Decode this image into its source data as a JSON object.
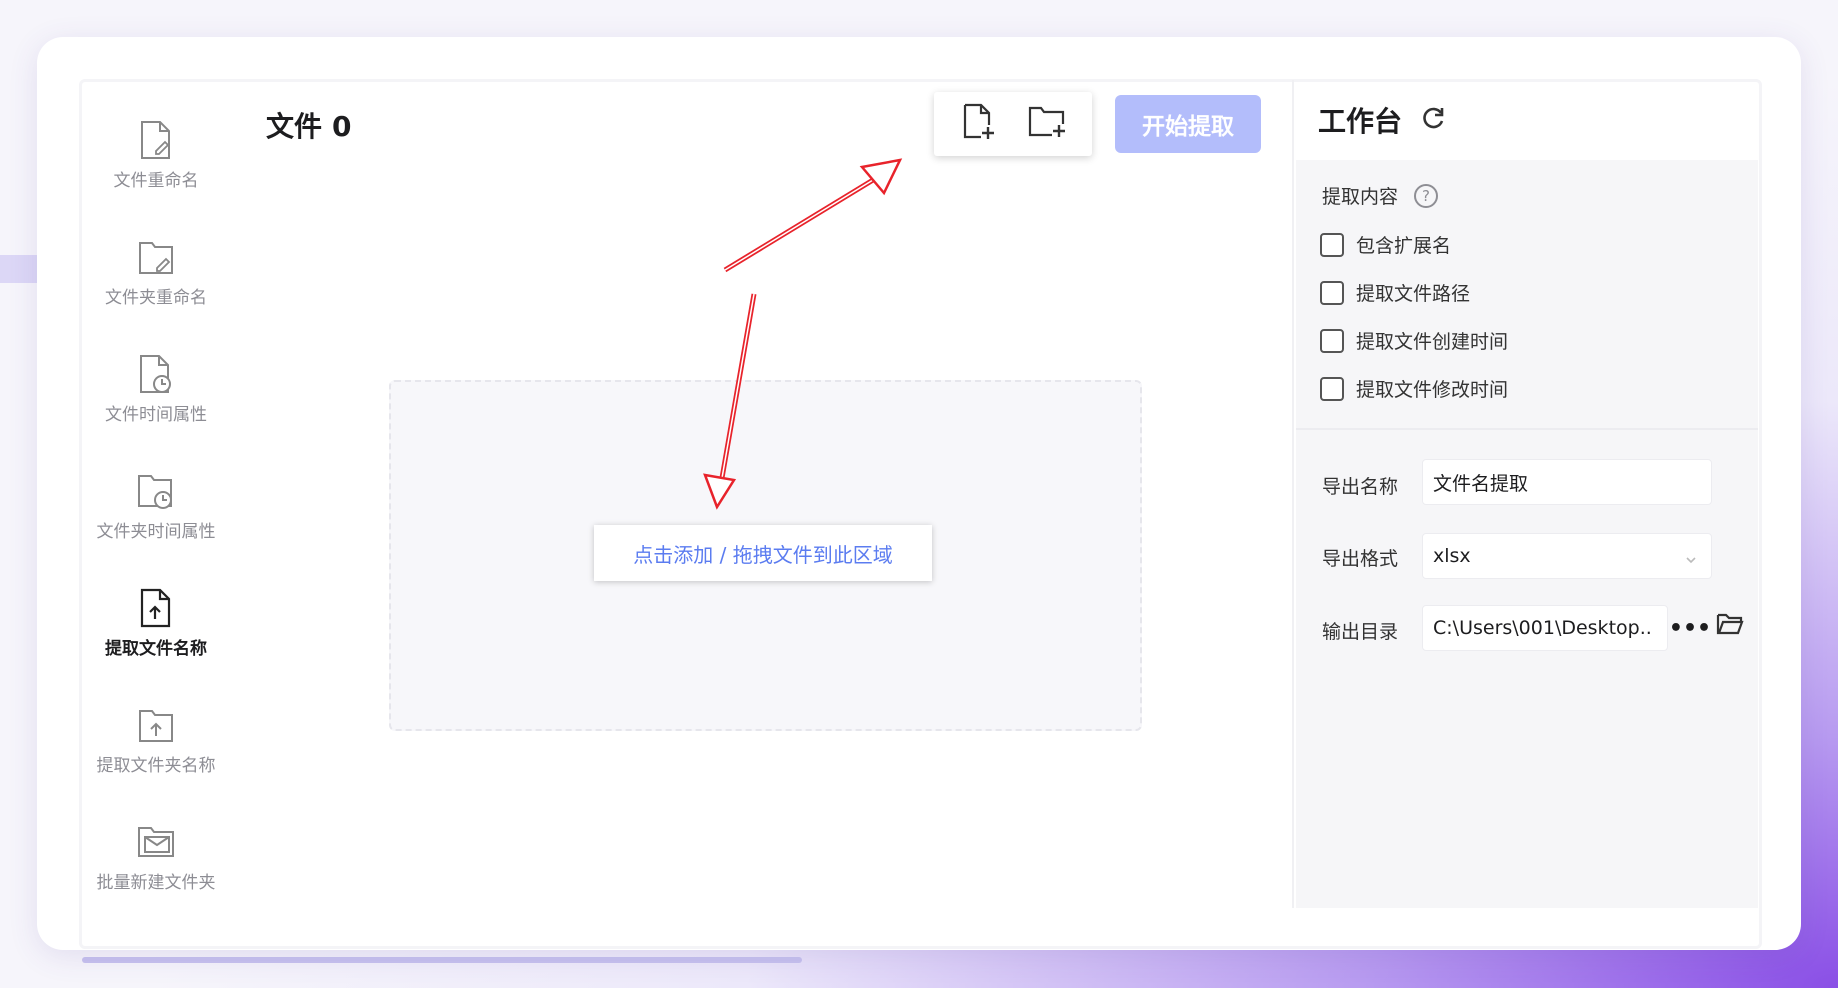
{
  "sidebar": {
    "items": [
      {
        "label": "文件重命名",
        "icon": "file-edit-icon"
      },
      {
        "label": "文件夹重命名",
        "icon": "folder-edit-icon"
      },
      {
        "label": "文件时间属性",
        "icon": "file-clock-icon"
      },
      {
        "label": "文件夹时间属性",
        "icon": "folder-clock-icon"
      },
      {
        "label": "提取文件名称",
        "icon": "file-upload-icon",
        "active": true
      },
      {
        "label": "提取文件夹名称",
        "icon": "folder-upload-icon"
      },
      {
        "label": "批量新建文件夹",
        "icon": "folder-mail-icon"
      }
    ]
  },
  "main": {
    "title_label": "文件",
    "file_count": "0",
    "start_button": "开始提取",
    "drop_label": "点击添加 / 拖拽文件到此区域",
    "add_file_icon": "add-file-icon",
    "add_folder_icon": "add-folder-icon"
  },
  "panel": {
    "title": "工作台",
    "refresh_icon": "refresh-icon",
    "section_title": "提取内容",
    "help_glyph": "?",
    "options": [
      {
        "label": "包含扩展名",
        "checked": false
      },
      {
        "label": "提取文件路径",
        "checked": false
      },
      {
        "label": "提取文件创建时间",
        "checked": false
      },
      {
        "label": "提取文件修改时间",
        "checked": false
      }
    ],
    "export_name_label": "导出名称",
    "export_name_value": "文件名提取",
    "export_format_label": "导出格式",
    "export_format_value": "xlsx",
    "output_dir_label": "输出目录",
    "output_dir_value": "C:\\Users\\001\\Desktop..",
    "more_glyph": "•••"
  },
  "colors": {
    "accent": "#5b7cf0",
    "start_button_bg": "#b3bdfb",
    "arrow": "#e8232b"
  }
}
